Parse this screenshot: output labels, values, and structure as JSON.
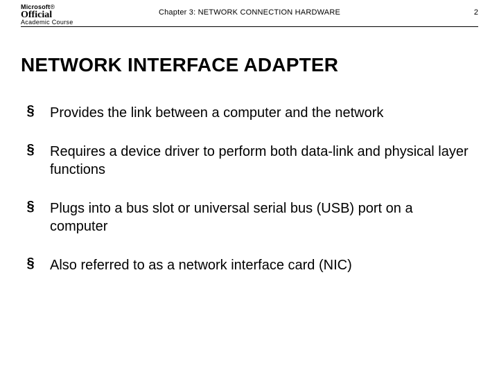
{
  "header": {
    "logo_brand_prefix": "Microsoft",
    "logo_brand_reg": "®",
    "logo_line2": "Official",
    "logo_line3": "Academic Course",
    "chapter": "Chapter 3: NETWORK CONNECTION HARDWARE",
    "page_number": "2"
  },
  "title": "NETWORK INTERFACE ADAPTER",
  "bullets": [
    "Provides the link between a computer and the network",
    "Requires a device driver to perform both data-link and physical layer functions",
    "Plugs into a bus slot or universal serial bus (USB) port on a computer",
    "Also referred to as a network interface card (NIC)"
  ],
  "bullet_marker": "§"
}
